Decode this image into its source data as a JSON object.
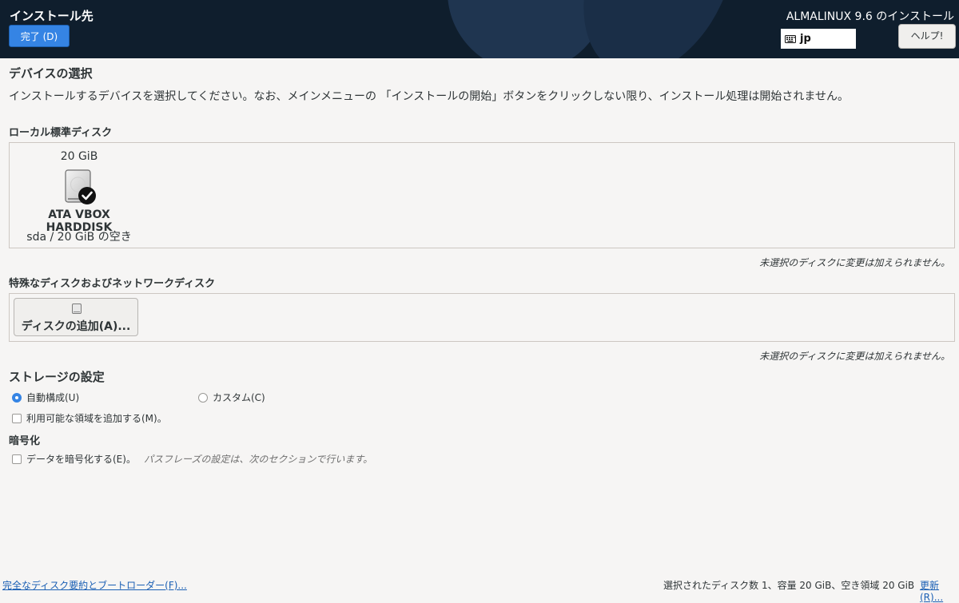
{
  "header": {
    "spoke_title": "インストール先",
    "done_button": "完了 (D)",
    "product_title": "ALMALINUX 9.6 のインストール",
    "keyboard_layout": "jp",
    "help_button": "ヘルプ!"
  },
  "device_selection": {
    "heading": "デバイスの選択",
    "description": "インストールするデバイスを選択してください。なお、メインメニューの 「インストールの開始」ボタンをクリックしない限り、インストール処理は開始されません。",
    "local_label": "ローカル標準ディスク",
    "disks": [
      {
        "size": "20 GiB",
        "name": "ATA VBOX HARDDISK",
        "free_text": "sda  /  20 GiB の空き",
        "selected": true
      }
    ],
    "local_note": "未選択のディスクに変更は加えられません。",
    "special_label": "特殊なディスクおよびネットワークディスク",
    "add_disk_button": "ディスクの追加(A)...",
    "special_note": "未選択のディスクに変更は加えられません。"
  },
  "storage_config": {
    "heading": "ストレージの設定",
    "auto_label": "自動構成(U)",
    "auto_selected": true,
    "custom_label": "カスタム(C)",
    "custom_selected": false,
    "reclaim_label": "利用可能な領域を追加する(M)。",
    "reclaim_checked": false
  },
  "encryption": {
    "heading": "暗号化",
    "encrypt_label": "データを暗号化する(E)。",
    "encrypt_checked": false,
    "hint": "パスフレーズの設定は、次のセクションで行います。"
  },
  "footer": {
    "summary_link": "完全なディスク要約とブートローダー(F)...",
    "status": "選択されたディスク数 1、容量 20 GiB、空き領域 20 GiB",
    "refresh_link": "更新(R)..."
  },
  "colors": {
    "header_bg": "#0f1e2d",
    "accent": "#3584e4",
    "link": "#1a5fb4"
  }
}
